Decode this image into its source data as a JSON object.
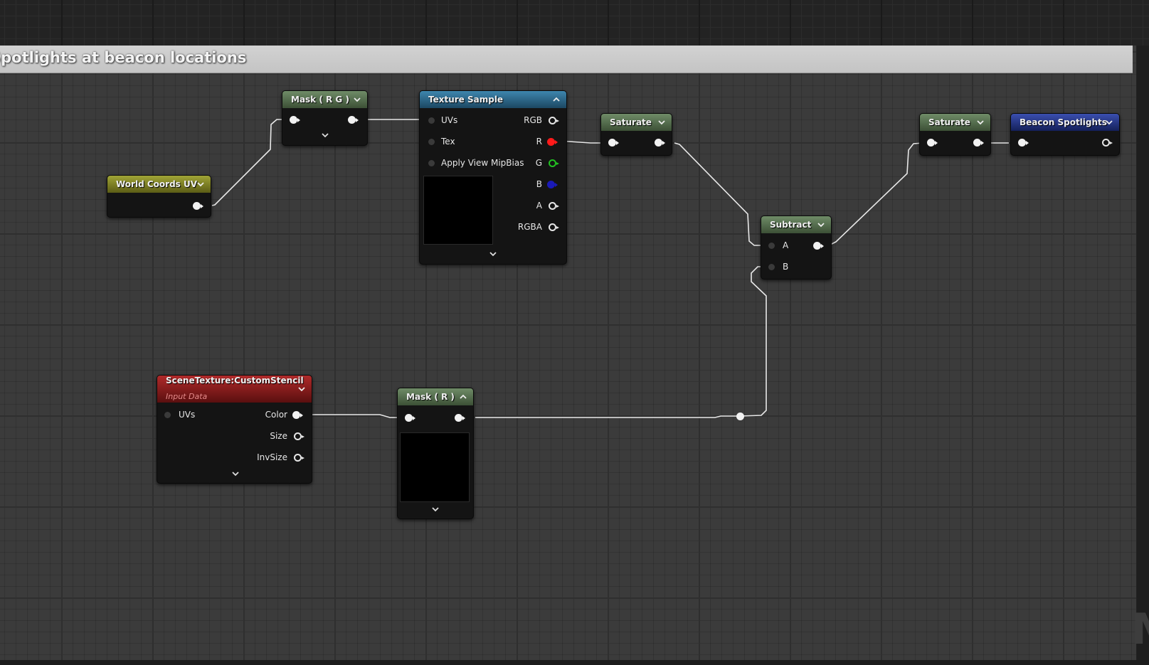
{
  "comment": {
    "title": "Spotlights at beacon locations"
  },
  "nodes": {
    "world_coords_uv": {
      "title": "World Coords UV"
    },
    "mask_rg": {
      "title": "Mask ( R G )"
    },
    "texture_sample": {
      "title": "Texture Sample",
      "inputs": [
        "UVs",
        "Tex",
        "Apply View MipBias"
      ],
      "outputs": [
        "RGB",
        "R",
        "G",
        "B",
        "A",
        "RGBA"
      ]
    },
    "saturate_1": {
      "title": "Saturate"
    },
    "subtract": {
      "title": "Subtract",
      "inputs": [
        "A",
        "B"
      ]
    },
    "saturate_2": {
      "title": "Saturate"
    },
    "beacon_spotlights": {
      "title": "Beacon Spotlights"
    },
    "scene_texture": {
      "title": "SceneTexture:CustomStencil",
      "subtitle": "Input Data",
      "inputs": [
        "UVs"
      ],
      "outputs": [
        "Color",
        "Size",
        "InvSize"
      ]
    },
    "mask_r": {
      "title": "Mask ( R )"
    }
  },
  "colors": {
    "canvas": "#3b3b3b",
    "comment_header": "#c8c8c8",
    "pin_red": "#ff1a1a",
    "pin_green": "#22c022",
    "pin_blue": "#1a1ab8",
    "header_green": "#55704d",
    "header_teal": "#2b6a8e",
    "header_yellow": "#8a8d25",
    "header_red": "#8d1c1c",
    "header_blue": "#2a3a8e"
  },
  "icons": {
    "collapse": "chevron-down-icon",
    "expand": "chevron-up-icon"
  }
}
